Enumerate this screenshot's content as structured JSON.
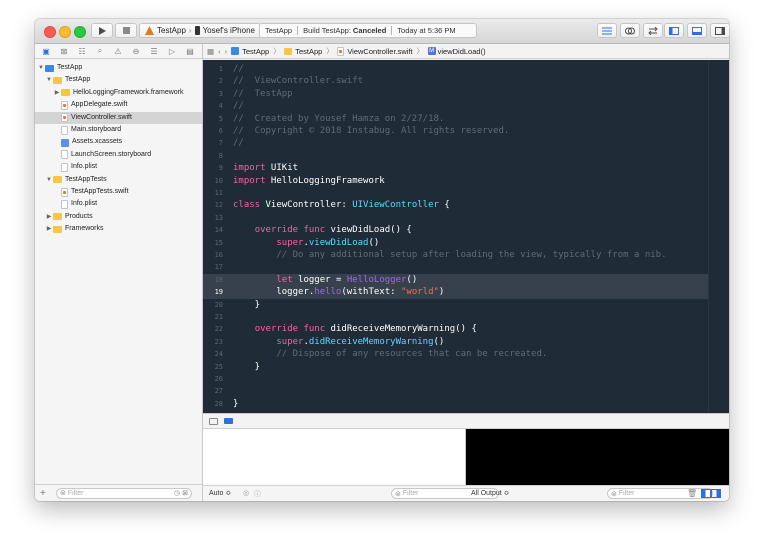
{
  "toolbar": {
    "scheme_name": "TestApp",
    "device_name": "Yosef's iPhone",
    "activity_project": "TestApp",
    "activity_status_prefix": "Build TestApp:",
    "activity_status": "Canceled",
    "activity_time": "Today at 5:36 PM"
  },
  "jumpbar": {
    "crumbs": [
      "TestApp",
      "TestApp",
      "ViewController.swift",
      "viewDidLoad()"
    ]
  },
  "navigator": {
    "items": [
      {
        "label": "TestApp",
        "disclosure": "▼",
        "icon": "project-icon"
      },
      {
        "label": "TestApp",
        "disclosure": "▼",
        "icon": "folder-icon"
      },
      {
        "label": "HelloLoggingFramework.framework",
        "disclosure": "▶",
        "icon": "framework-icon"
      },
      {
        "label": "AppDelegate.swift",
        "disclosure": "",
        "icon": "swift-file-icon"
      },
      {
        "label": "ViewController.swift",
        "disclosure": "",
        "icon": "swift-file-icon"
      },
      {
        "label": "Main.storyboard",
        "disclosure": "",
        "icon": "storyboard-icon"
      },
      {
        "label": "Assets.xcassets",
        "disclosure": "",
        "icon": "assets-icon"
      },
      {
        "label": "LaunchScreen.storyboard",
        "disclosure": "",
        "icon": "storyboard-icon"
      },
      {
        "label": "Info.plist",
        "disclosure": "",
        "icon": "plist-icon"
      },
      {
        "label": "TestAppTests",
        "disclosure": "▼",
        "icon": "folder-icon"
      },
      {
        "label": "TestAppTests.swift",
        "disclosure": "",
        "icon": "swift-file-icon"
      },
      {
        "label": "Info.plist",
        "disclosure": "",
        "icon": "plist-icon"
      },
      {
        "label": "Products",
        "disclosure": "▶",
        "icon": "folder-icon"
      },
      {
        "label": "Frameworks",
        "disclosure": "▶",
        "icon": "folder-icon"
      }
    ],
    "filter_placeholder": "Filter"
  },
  "editor": {
    "current_line": 19,
    "lines": [
      {
        "n": "1",
        "t": [
          [
            "com",
            "//"
          ]
        ]
      },
      {
        "n": "2",
        "t": [
          [
            "com",
            "//  ViewController.swift"
          ]
        ]
      },
      {
        "n": "3",
        "t": [
          [
            "com",
            "//  TestApp"
          ]
        ]
      },
      {
        "n": "4",
        "t": [
          [
            "com",
            "//"
          ]
        ]
      },
      {
        "n": "5",
        "t": [
          [
            "com",
            "//  Created by Yousef Hamza on 2/27/18."
          ]
        ]
      },
      {
        "n": "6",
        "t": [
          [
            "com",
            "//  Copyright © 2018 Instabug. All rights reserved."
          ]
        ]
      },
      {
        "n": "7",
        "t": [
          [
            "com",
            "//"
          ]
        ]
      },
      {
        "n": "8",
        "t": []
      },
      {
        "n": "9",
        "t": [
          [
            "kw",
            "import"
          ],
          [
            "plain",
            " UIKit"
          ]
        ]
      },
      {
        "n": "10",
        "t": [
          [
            "kw",
            "import"
          ],
          [
            "plain",
            " HelloLoggingFramework"
          ]
        ]
      },
      {
        "n": "11",
        "t": []
      },
      {
        "n": "12",
        "t": [
          [
            "kw",
            "class"
          ],
          [
            "plain",
            " ViewController: "
          ],
          [
            "sys",
            "UIViewController"
          ],
          [
            "plain",
            " {"
          ]
        ]
      },
      {
        "n": "13",
        "t": []
      },
      {
        "n": "14",
        "t": [
          [
            "plain",
            "    "
          ],
          [
            "kw",
            "override func"
          ],
          [
            "plain",
            " viewDidLoad() {"
          ]
        ]
      },
      {
        "n": "15",
        "t": [
          [
            "plain",
            "        "
          ],
          [
            "kw",
            "super"
          ],
          [
            "plain",
            "."
          ],
          [
            "sys",
            "viewDidLoad"
          ],
          [
            "plain",
            "()"
          ]
        ]
      },
      {
        "n": "16",
        "t": [
          [
            "plain",
            "        "
          ],
          [
            "com",
            "// Do any additional setup after loading the view, typically from a nib."
          ]
        ]
      },
      {
        "n": "17",
        "t": []
      },
      {
        "n": "18",
        "t": [
          [
            "plain",
            "        "
          ],
          [
            "kw",
            "let"
          ],
          [
            "plain",
            " logger = "
          ],
          [
            "type",
            "HelloLogger"
          ],
          [
            "plain",
            "()"
          ]
        ]
      },
      {
        "n": "19",
        "t": [
          [
            "plain",
            "        logger."
          ],
          [
            "type",
            "hello"
          ],
          [
            "plain",
            "(withText: "
          ],
          [
            "str",
            "\"world\""
          ],
          [
            "plain",
            ")"
          ]
        ]
      },
      {
        "n": "20",
        "t": [
          [
            "plain",
            "    }"
          ]
        ]
      },
      {
        "n": "21",
        "t": []
      },
      {
        "n": "22",
        "t": [
          [
            "plain",
            "    "
          ],
          [
            "kw",
            "override func"
          ],
          [
            "plain",
            " didReceiveMemoryWarning() {"
          ]
        ]
      },
      {
        "n": "23",
        "t": [
          [
            "plain",
            "        "
          ],
          [
            "kw",
            "super"
          ],
          [
            "plain",
            "."
          ],
          [
            "sys",
            "didReceiveMemoryWarning"
          ],
          [
            "plain",
            "()"
          ]
        ]
      },
      {
        "n": "24",
        "t": [
          [
            "plain",
            "        "
          ],
          [
            "com",
            "// Dispose of any resources that can be recreated."
          ]
        ]
      },
      {
        "n": "25",
        "t": [
          [
            "plain",
            "    }"
          ]
        ]
      },
      {
        "n": "26",
        "t": []
      },
      {
        "n": "27",
        "t": []
      },
      {
        "n": "28",
        "t": [
          [
            "plain",
            "}"
          ]
        ]
      }
    ]
  },
  "debug": {
    "variables_mode": "Auto ≎",
    "filter_placeholder": "Filter",
    "output_mode": "All Output ≎",
    "console_filter_placeholder": "Filter"
  },
  "colors": {
    "editor_background": "#1f2b37",
    "keyword": "#fc5fa3",
    "comment": "#5d6c79",
    "type": "#a167e6",
    "system": "#5dd8ff",
    "string": "#fc6a5d",
    "accent": "#2b70e0"
  }
}
